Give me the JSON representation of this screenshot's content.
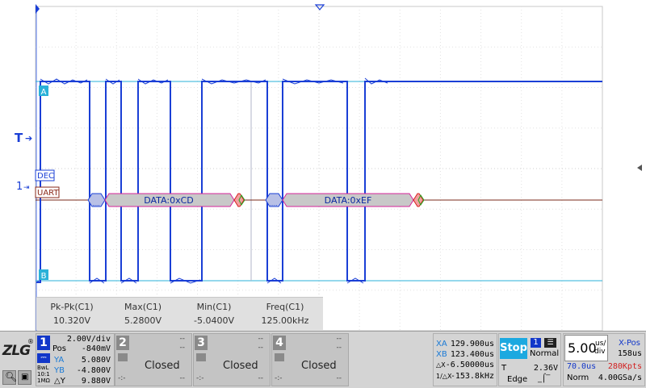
{
  "channel_markers": {
    "a": "A",
    "b": "B",
    "trigger": "T",
    "ch1": "1"
  },
  "decoder": {
    "labels": [
      "DEC",
      "UART"
    ],
    "frames": [
      "DATA:0xCD",
      "DATA:0xEF"
    ]
  },
  "measurements": [
    {
      "name": "Pk-Pk(C1)",
      "value": "10.320V"
    },
    {
      "name": "Max(C1)",
      "value": "5.2800V"
    },
    {
      "name": "Min(C1)",
      "value": "-5.0400V"
    },
    {
      "name": "Freq(C1)",
      "value": "125.00kHz"
    }
  ],
  "ch1_panel": {
    "number": "1",
    "volts_div": "2.00V/div",
    "pos_label": "Pos",
    "pos_value": "-840mV",
    "ya_label": "YA",
    "ya_value": "5.080V",
    "yb_label": "YB",
    "yb_value": "-4.800V",
    "dy_label": "△Y",
    "dy_value": "9.880V",
    "coupling": [
      "BwL",
      "10:1",
      "1MΩ"
    ]
  },
  "closed_channels": [
    {
      "number": "2",
      "status": "Closed",
      "dash": "--",
      "dash2": "-:-"
    },
    {
      "number": "3",
      "status": "Closed",
      "dash": "--",
      "dash2": "-:-"
    },
    {
      "number": "4",
      "status": "Closed",
      "dash": "--",
      "dash2": "-:-"
    }
  ],
  "cursors": {
    "xa_label": "XA",
    "xa_value": "129.900us",
    "xb_label": "XB",
    "xb_value": "123.400us",
    "dx_label": "△X",
    "dx_value": "-6.50000us",
    "inv_label": "1/△X",
    "inv_value": "-153.8kHz"
  },
  "run": {
    "state": "Stop",
    "mode": "Normal",
    "ch": "1"
  },
  "trigger": {
    "label": "T",
    "level": "2.36V",
    "type": "Edge"
  },
  "timebase": {
    "value": "5.00",
    "unit_top": "us/",
    "unit_bot": "div",
    "offset": "70.0us",
    "pts": "280Kpts",
    "acq": "Norm",
    "rate": "4.00GSa/s"
  },
  "xpos": {
    "label": "X-Pos",
    "value": "158us"
  },
  "brand": "ZLG",
  "colors": {
    "trace_a": "#1a3fd6",
    "cursor": "#2ab1d8",
    "ch1": "#1237c9",
    "decode_fill": "#c8c8c8",
    "decode_border": "#d6249a",
    "stop": "#1ca9e0",
    "pts": "#d22020"
  }
}
